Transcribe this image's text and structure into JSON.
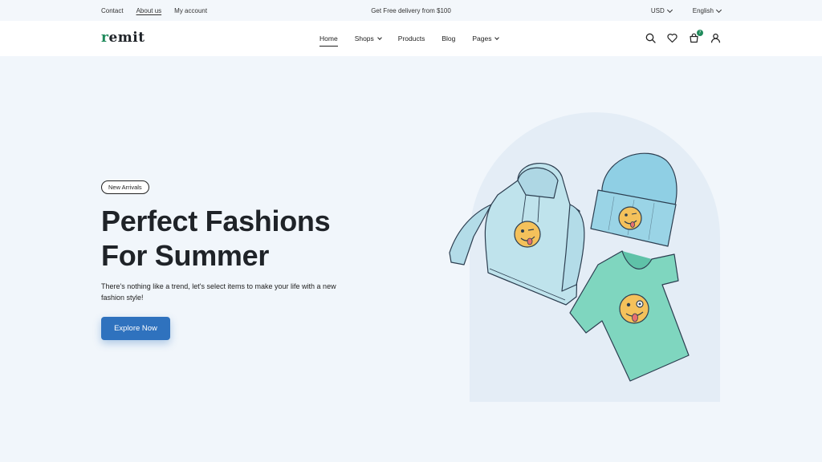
{
  "topbar": {
    "links": [
      "Contact",
      "About us",
      "My account"
    ],
    "promo": "Get Free delivery from $100",
    "currency": "USD",
    "language": "English"
  },
  "header": {
    "logo": "remit",
    "nav": [
      {
        "label": "Home"
      },
      {
        "label": "Shops"
      },
      {
        "label": "Products"
      },
      {
        "label": "Blog"
      },
      {
        "label": "Pages"
      }
    ],
    "cart_count": "7",
    "icons": [
      "search-icon",
      "heart-icon",
      "cart-icon",
      "user-icon"
    ]
  },
  "hero": {
    "badge": "New Arrivals",
    "title_line1": "Perfect Fashions",
    "title_line2": "For Summer",
    "text": "There's nothing like a trend, let's select items to make your life with a new fashion style!",
    "cta": "Explore Now"
  },
  "colors": {
    "accent": "#2f72be",
    "brand_green": "#1f8a5b",
    "background": "#f1f6fb",
    "arch": "#e4edf6"
  }
}
